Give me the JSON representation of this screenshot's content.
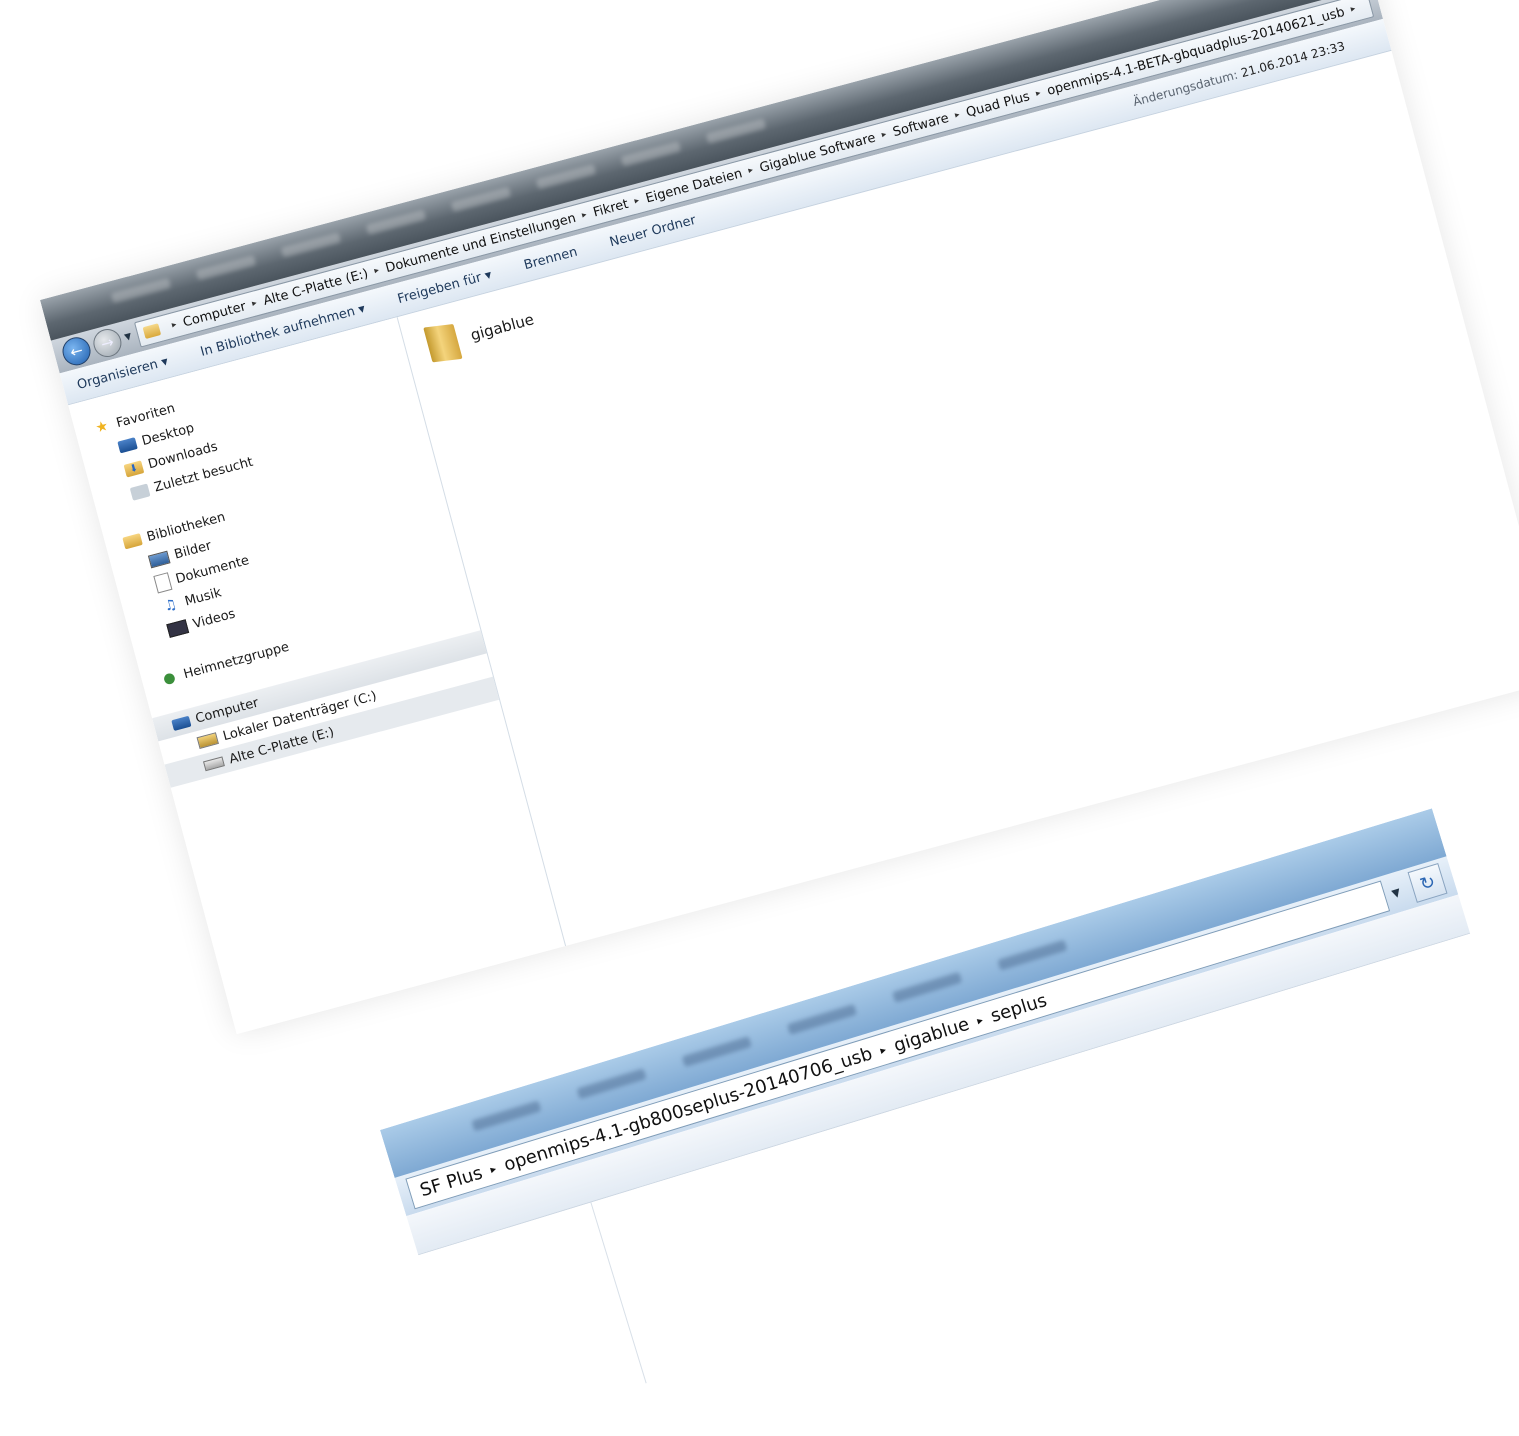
{
  "window1": {
    "nav": {
      "back_icon": "back-arrow-icon",
      "forward_icon": "forward-arrow-icon"
    },
    "breadcrumb": [
      "Computer",
      "Alte C-Platte (E:)",
      "Dokumente und Einstellungen",
      "Fikret",
      "Eigene Dateien",
      "Gigablue Software",
      "Software",
      "Quad Plus",
      "openmips-4.1-BETA-gbquadplus-20140621_usb"
    ],
    "toolbar": {
      "organize": "Organisieren ▾",
      "include_library": "In Bibliothek aufnehmen ▾",
      "share": "Freigeben für ▾",
      "burn": "Brennen",
      "new_folder": "Neuer Ordner",
      "date_label": "Änderungsdatum:",
      "date_value": "21.06.2014 23:33"
    },
    "sidebar": {
      "favorites": "Favoriten",
      "desktop": "Desktop",
      "downloads": "Downloads",
      "recent": "Zuletzt besucht",
      "libraries": "Bibliotheken",
      "pictures": "Bilder",
      "documents": "Dokumente",
      "music": "Musik",
      "videos": "Videos",
      "homegroup": "Heimnetzgruppe",
      "computer": "Computer",
      "drive_c": "Lokaler Datenträger (C:)",
      "drive_e": "Alte C-Platte (E:)"
    },
    "files": [
      {
        "name": "gigablue",
        "icon": "folder-icon"
      }
    ]
  },
  "window2": {
    "breadcrumb": [
      "SF Plus",
      "openmips-4.1-gb800seplus-20140706_usb",
      "gigablue",
      "seplus"
    ]
  }
}
